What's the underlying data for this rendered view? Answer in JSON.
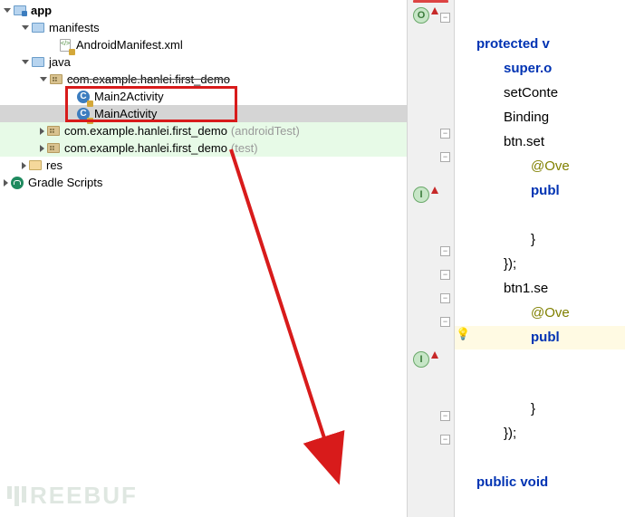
{
  "tree": {
    "app": "app",
    "manifests": "manifests",
    "manifest_file": "AndroidManifest.xml",
    "java": "java",
    "pkg_main": "com.example.hanlei.first_demo",
    "main2": "Main2Activity",
    "main": "MainActivity",
    "pkg_atest": "com.example.hanlei.first_demo",
    "pkg_atest_hint": "(androidTest)",
    "pkg_test": "com.example.hanlei.first_demo",
    "pkg_test_hint": "(test)",
    "res": "res",
    "gradle": "Gradle Scripts"
  },
  "code": {
    "l1": "protected v",
    "l2": "super.o",
    "l3": "setConte",
    "l4": "Binding",
    "l5": "btn.set",
    "l6": "@Ove",
    "l7": "publ",
    "l8": "",
    "l9": "}",
    "l10": "});",
    "l11": "btn1.se",
    "l12": "@Ove",
    "l13": "publ",
    "l14": "",
    "l15": "}",
    "l16": "});",
    "l17": "",
    "l18": "public void"
  },
  "watermark": "REEBUF"
}
